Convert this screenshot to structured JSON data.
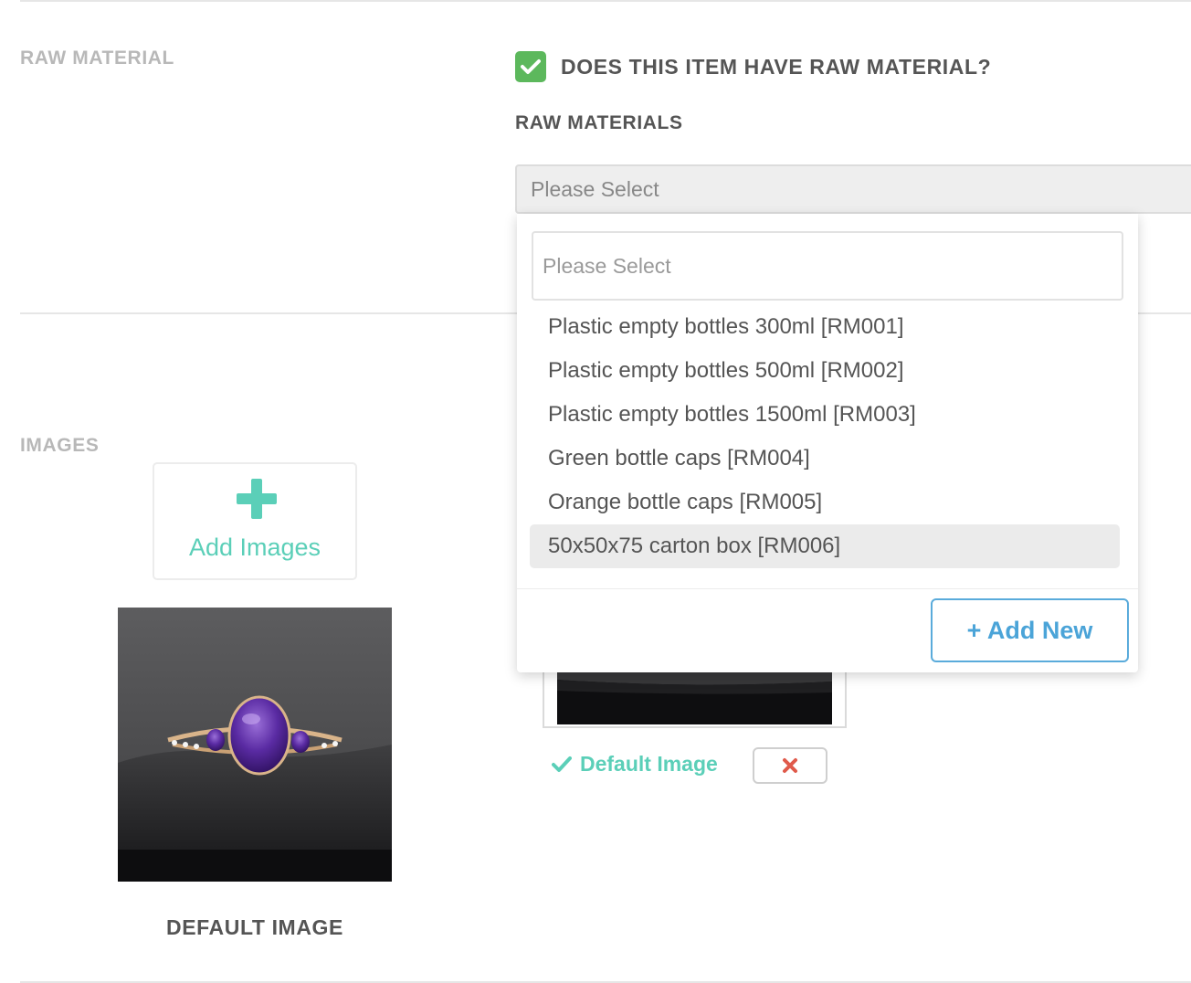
{
  "raw_material_section": {
    "label": "RAW MATERIAL",
    "has_raw_material_question": "DOES THIS ITEM HAVE RAW MATERIAL?",
    "has_raw_material_checked": true,
    "field_label": "RAW MATERIALS",
    "select_value": "Please Select",
    "dropdown": {
      "search_placeholder": "Please Select",
      "options": [
        "Plastic empty bottles 300ml [RM001]",
        "Plastic empty bottles 500ml [RM002]",
        "Plastic empty bottles 1500ml [RM003]",
        "Green bottle caps [RM004]",
        "Orange bottle caps [RM005]",
        "50x50x75 carton box [RM006]"
      ],
      "highlighted_option": "50x50x75 carton box [RM006]",
      "add_new_label": "+ Add New"
    }
  },
  "images_section": {
    "label": "IMAGES",
    "add_images_label": "Add Images",
    "default_image_caption": "DEFAULT IMAGE",
    "default_badge_label": "Default Image",
    "delete_icon": "close-icon"
  },
  "colors": {
    "accent_teal": "#5bcfb8",
    "checkbox_green": "#5cb85c",
    "add_new_blue": "#4ba4d8",
    "delete_red": "#e05a4b"
  }
}
